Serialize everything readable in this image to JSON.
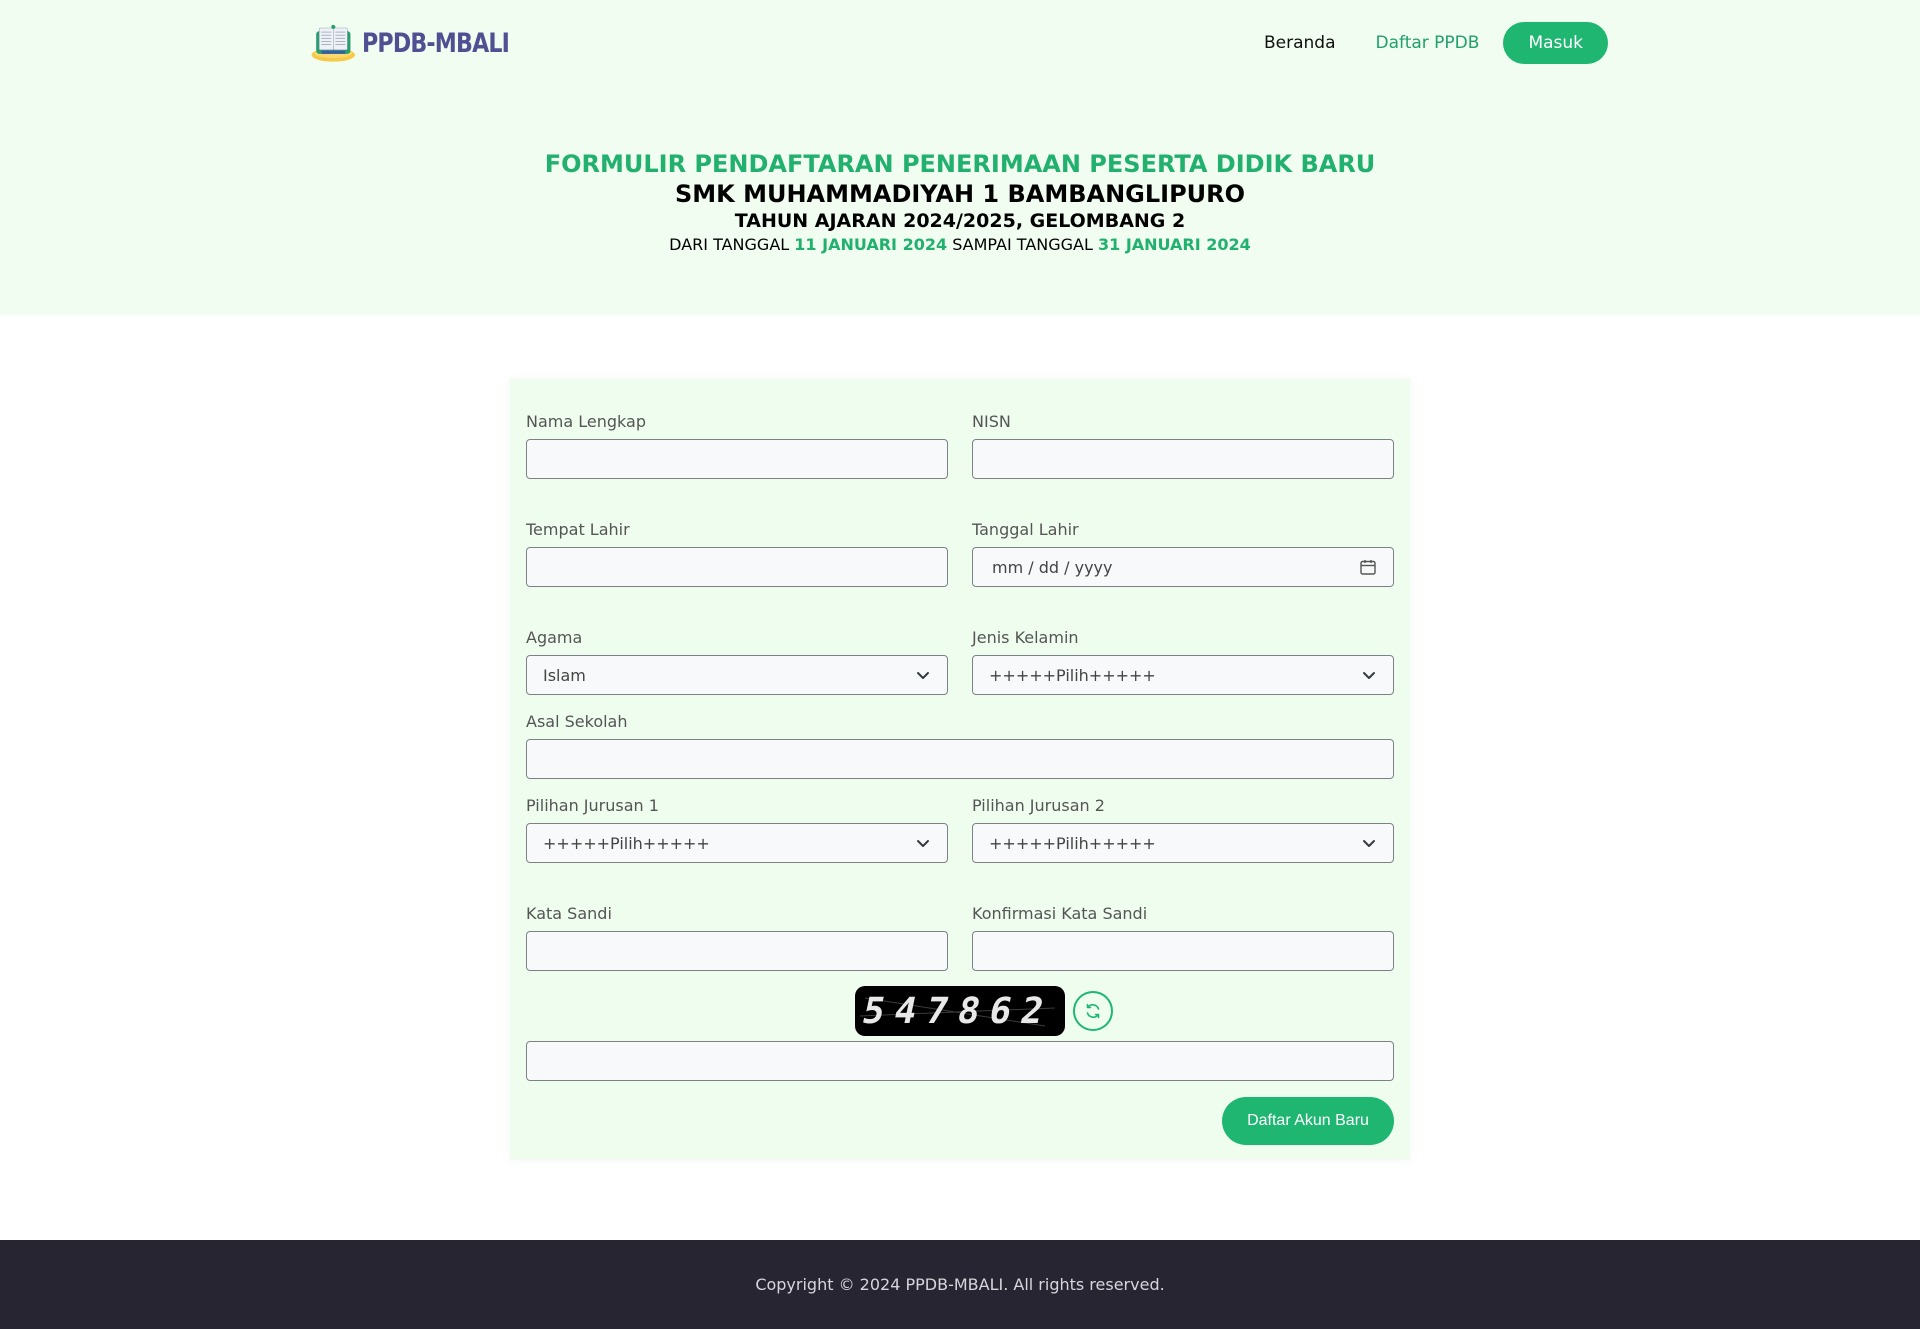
{
  "brand": {
    "name": "PPDB-MBALI"
  },
  "nav": {
    "home": "Beranda",
    "register": "Daftar PPDB",
    "login": "Masuk"
  },
  "header": {
    "title": "FORMULIR PENDAFTARAN PENERIMAAN PESERTA DIDIK BARU",
    "school": "SMK MUHAMMADIYAH 1 BAMBANGLIPURO",
    "year": "TAHUN AJARAN 2024/2025, GELOMBANG 2",
    "from_label": "DARI TANGGAL",
    "from_date": "11 JANUARI 2024",
    "to_label": "SAMPAI TANGGAL",
    "to_date": "31 JANUARI 2024"
  },
  "form": {
    "nama_label": "Nama Lengkap",
    "nama_value": "",
    "nisn_label": "NISN",
    "nisn_value": "",
    "tempat_label": "Tempat Lahir",
    "tempat_value": "",
    "tanggal_label": "Tanggal Lahir",
    "tanggal_placeholder": "mm / dd / yyyy",
    "agama_label": "Agama",
    "agama_value": "Islam",
    "jk_label": "Jenis Kelamin",
    "jk_value": "+++++Pilih+++++",
    "sekolah_label": "Asal Sekolah",
    "sekolah_value": "",
    "jurusan1_label": "Pilihan Jurusan 1",
    "jurusan1_value": "+++++Pilih+++++",
    "jurusan2_label": "Pilihan Jurusan 2",
    "jurusan2_value": "+++++Pilih+++++",
    "sandi_label": "Kata Sandi",
    "sandi_value": "",
    "konfirmasi_label": "Konfirmasi Kata Sandi",
    "konfirmasi_value": "",
    "captcha_code": "547862",
    "captcha_value": "",
    "submit_label": "Daftar Akun Baru"
  },
  "footer": {
    "copyright": "Copyright © 2024 PPDB-MBALI. All rights reserved."
  },
  "colors": {
    "accent": "#1fb672",
    "hero_bg": "#f0fdf0",
    "card_bg": "#effdef",
    "footer_bg": "#282532",
    "brand_text": "#4f4f92"
  },
  "icons": {
    "logo": "open-book-icon",
    "select": "chevron-down-icon",
    "date": "calendar-icon",
    "captcha_refresh": "refresh-icon"
  }
}
